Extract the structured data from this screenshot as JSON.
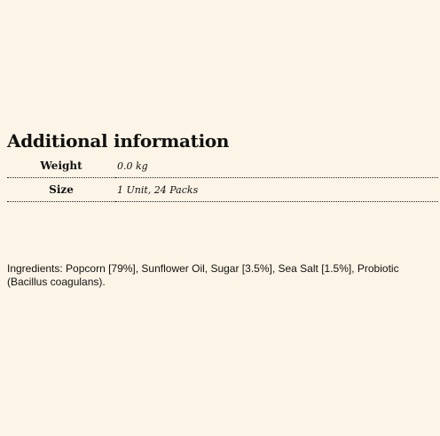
{
  "additional_information": {
    "title": "Additional information",
    "rows": [
      {
        "label": "Weight",
        "value": "0.0 kg"
      },
      {
        "label": "Size",
        "value": "1 Unit, 24 Packs"
      }
    ]
  },
  "ingredients": {
    "text": "Ingredients: Popcorn [79%], Sunflower Oil, Sugar [3.5%], Sea Salt [1.5%], Probiotic (Bacillus coagulans)."
  },
  "colors": {
    "background": "#fcf4e6",
    "text": "#111111"
  }
}
